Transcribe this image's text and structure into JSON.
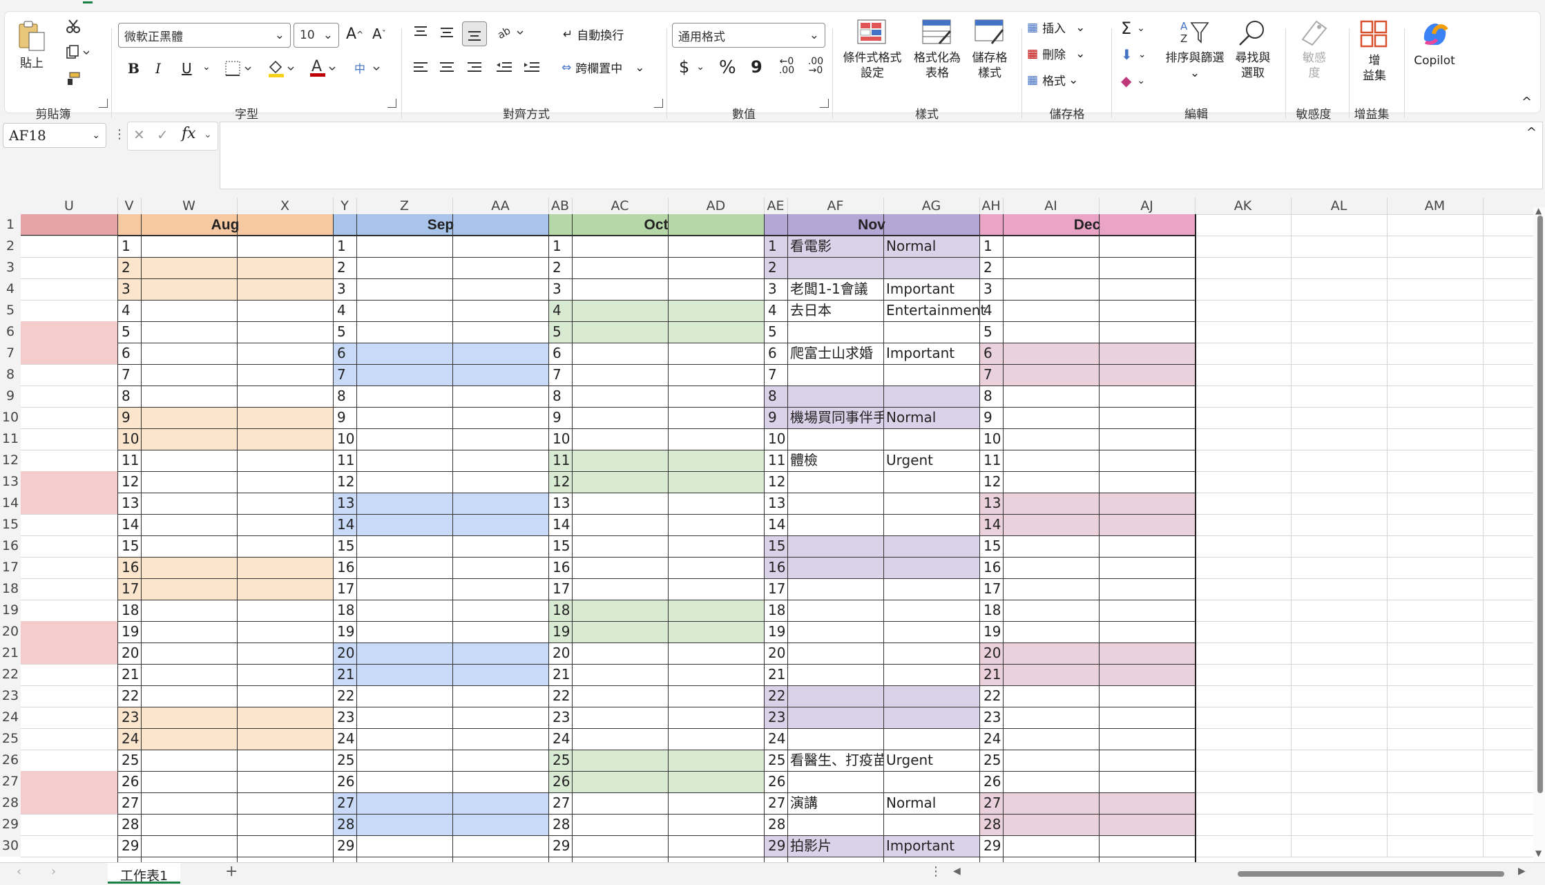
{
  "ribbon": {
    "clipboard": {
      "group_label": "剪貼簿",
      "paste_label": "貼上"
    },
    "font": {
      "group_label": "字型",
      "font_name": "微軟正黑體",
      "font_size": "10",
      "bold": "B",
      "italic": "I",
      "underline": "U",
      "grow": "A^",
      "shrink": "A˅"
    },
    "alignment": {
      "group_label": "對齊方式",
      "wrap_text": "自動換行",
      "merge_center": "跨欄置中"
    },
    "number": {
      "group_label": "數值",
      "format": "通用格式",
      "currency": "$",
      "percent": "%",
      "comma": "9",
      "inc_decimal": "←0 .00",
      "dec_decimal": ".00 →0"
    },
    "styles": {
      "group_label": "樣式",
      "conditional": "條件式格式設定",
      "conditional_l1": "條件式格式",
      "conditional_l2": "設定",
      "format_table_l1": "格式化為",
      "format_table_l2": "表格",
      "cell_styles_l1": "儲存格",
      "cell_styles_l2": "樣式"
    },
    "cells": {
      "group_label": "儲存格",
      "insert": "插入",
      "delete": "刪除",
      "format": "格式"
    },
    "editing": {
      "group_label": "編輯",
      "sort_filter_l1": "排序與篩選",
      "find_select_l1": "尋找與",
      "find_select_l2": "選取"
    },
    "sensitivity": {
      "group_label": "敏感度",
      "label_l1": "敏感",
      "label_l2": "度"
    },
    "addins": {
      "group_label": "增益集",
      "label_l1": "增",
      "label_l2": "益集"
    },
    "copilot": {
      "label": "Copilot"
    }
  },
  "formula_bar": {
    "name_box": "AF18",
    "fx": "fx",
    "formula": ""
  },
  "columns": [
    "U",
    "V",
    "W",
    "X",
    "Y",
    "Z",
    "AA",
    "AB",
    "AC",
    "AD",
    "AE",
    "AF",
    "AG",
    "AH",
    "AI",
    "AJ",
    "AK",
    "AL",
    "AM"
  ],
  "rows": [
    "1",
    "2",
    "3",
    "4",
    "5",
    "6",
    "7",
    "8",
    "9",
    "10",
    "11",
    "12",
    "13",
    "14",
    "15",
    "16",
    "17",
    "18",
    "19",
    "20",
    "21",
    "22",
    "23",
    "24",
    "25",
    "26",
    "27",
    "28",
    "29",
    "30"
  ],
  "months": [
    "Aug",
    "Sep",
    "Oct",
    "Nov",
    "Dec"
  ],
  "month_colors": {
    "Jul": "#e6a3a8",
    "Aug": "#f6c9a3",
    "Sep": "#a8c4ea",
    "Oct": "#b6d7a8",
    "Nov": "#b4a7d6",
    "Dec": "#eaa4c6"
  },
  "weekend_colors": {
    "Jul": "#f4cccc",
    "Aug": "#fce5cd",
    "Sep": "#c9daf8",
    "Oct": "#d9ead3",
    "Nov": "#d9d2e9",
    "Dec": "#ead1dc"
  },
  "days": [
    "1",
    "2",
    "3",
    "4",
    "5",
    "6",
    "7",
    "8",
    "9",
    "10",
    "11",
    "12",
    "13",
    "14",
    "15",
    "16",
    "17",
    "18",
    "19",
    "20",
    "21",
    "22",
    "23",
    "24",
    "25",
    "26",
    "27",
    "28",
    "29"
  ],
  "weekend_days": {
    "Jul": [
      5,
      6,
      12,
      13,
      19,
      20,
      26,
      27
    ],
    "Aug": [
      2,
      3,
      9,
      10,
      16,
      17,
      23,
      24
    ],
    "Sep": [
      6,
      7,
      13,
      14,
      20,
      21,
      27,
      28
    ],
    "Oct": [
      4,
      5,
      11,
      12,
      18,
      19,
      25,
      26
    ],
    "Nov": [
      1,
      2,
      8,
      9,
      15,
      16,
      22,
      23,
      29
    ],
    "Dec": [
      6,
      7,
      13,
      14,
      20,
      21,
      27,
      28
    ]
  },
  "nov_events": [
    {
      "day": 1,
      "title": "看電影",
      "tag": "Normal"
    },
    {
      "day": 3,
      "title": "老闆1-1會議",
      "tag": "Important"
    },
    {
      "day": 4,
      "title": "去日本",
      "tag": "Entertainment"
    },
    {
      "day": 6,
      "title": "爬富士山求婚",
      "tag": "Important"
    },
    {
      "day": 9,
      "title": "機場買同事伴手",
      "tag": "Normal"
    },
    {
      "day": 11,
      "title": "體檢",
      "tag": "Urgent"
    },
    {
      "day": 25,
      "title": "看醫生、打疫苗",
      "tag": "Urgent"
    },
    {
      "day": 27,
      "title": "演講",
      "tag": "Normal"
    },
    {
      "day": 29,
      "title": "拍影片",
      "tag": "Important"
    }
  ],
  "sheet_tab": "工作表1",
  "add_sheet": "+"
}
